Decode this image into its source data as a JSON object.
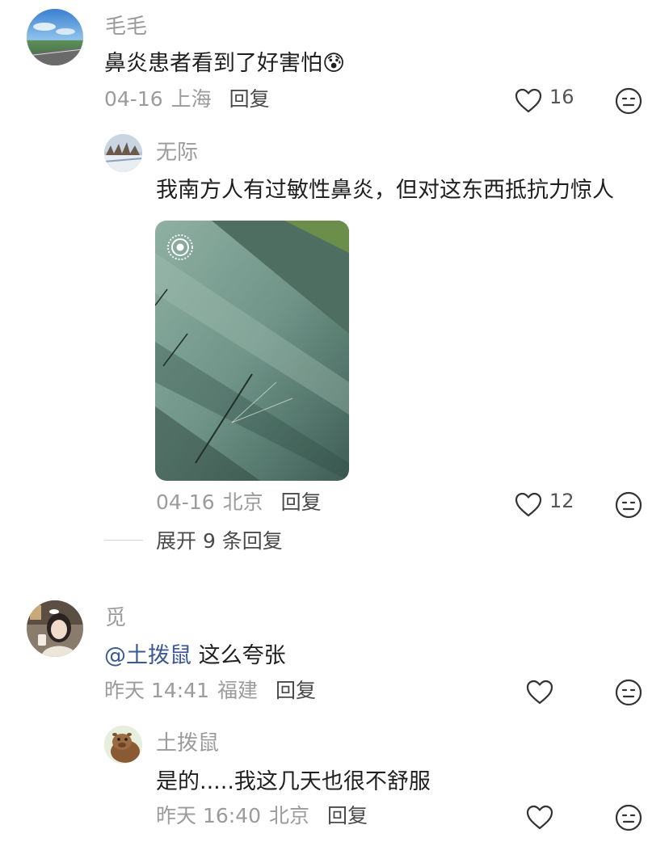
{
  "comments": [
    {
      "username": "毛毛",
      "content": "鼻炎患者看到了好害怕",
      "emoji": "😰",
      "date": "04-16",
      "location": "上海",
      "reply_label": "回复",
      "likes": "16",
      "replies": [
        {
          "username": "无际",
          "content": "我南方人有过敏性鼻炎，但对这东西抵抗力惊人",
          "date": "04-16",
          "location": "北京",
          "reply_label": "回复",
          "likes": "12",
          "image": "live-photo"
        }
      ],
      "expand_label": "展开 9 条回复"
    },
    {
      "username": "觅",
      "mention": "@土拨鼠",
      "content": "这么夸张",
      "date": "昨天 14:41",
      "location": "福建",
      "reply_label": "回复",
      "likes": "",
      "replies": [
        {
          "username": "土拨鼠",
          "content": "是的.....我这几天也很不舒服",
          "date": "昨天 16:40",
          "location": "北京",
          "reply_label": "回复",
          "likes": ""
        }
      ]
    }
  ],
  "icons": {
    "like": "heart-outline-icon",
    "dislike": "neutral-face-icon",
    "live_photo": "live-photo-icon"
  },
  "colors": {
    "username": "#9b9b9b",
    "text": "#1f1f1f",
    "mention": "#3b5a91",
    "meta": "#9b9b9b"
  }
}
